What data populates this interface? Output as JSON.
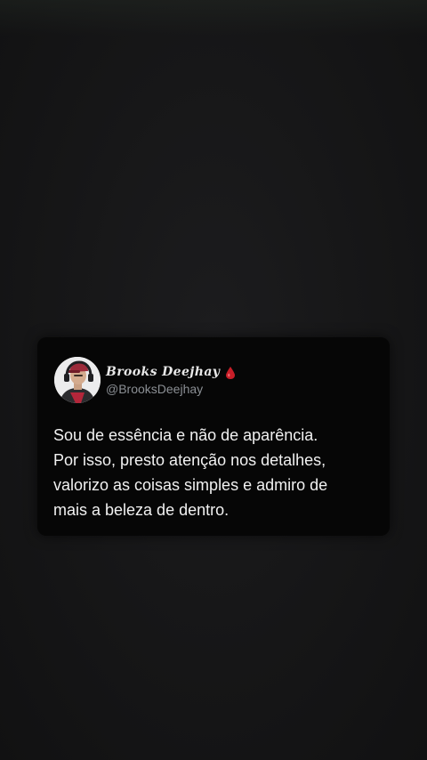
{
  "tweet": {
    "author": {
      "display_name": "Brooks Deejhay",
      "handle": "@BrooksDeejhay",
      "avatar_icon": "profile-photo",
      "name_emoji_icon": "blood-drop-icon"
    },
    "text_lines": [
      "Sou de essência e não de aparência.",
      "Por isso, presto atenção nos detalhes,",
      "valorizo as coisas simples e admiro de",
      "mais a beleza de dentro."
    ]
  },
  "colors": {
    "background": "#161617",
    "card": "#060606",
    "text_primary": "#f1f1f1",
    "text_secondary": "#8b8f94",
    "drop_accent": "#c81e28"
  }
}
